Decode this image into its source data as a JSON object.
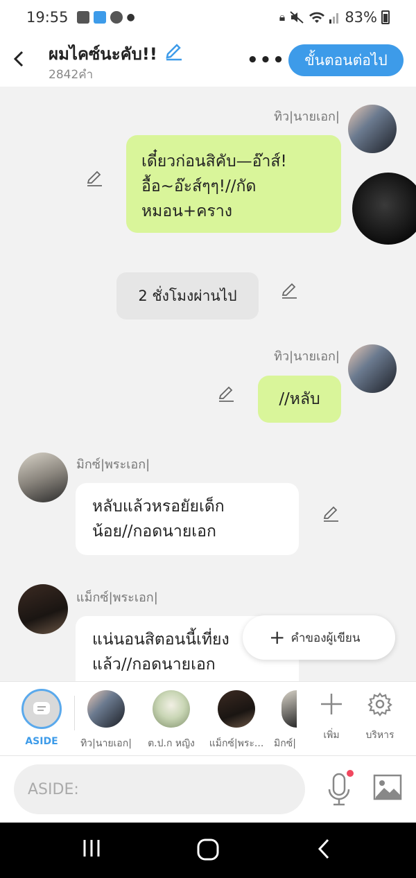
{
  "status": {
    "time": "19:55",
    "battery": "83%"
  },
  "header": {
    "title": "ผมไคซ์นะคับ!!",
    "word_count": "2842คำ",
    "more": "•••",
    "next_button": "ขั้นตอนต่อไป"
  },
  "messages": [
    {
      "speaker": "ทิว|นายเอก|",
      "text_lines": [
        "เดี๋ยวก่อนสิคับ—อ๊าส์!",
        "อื้อ~อ๊ะส์ๆๆ!//กัด",
        "หมอน+คราง"
      ]
    },
    {
      "system": "2 ชั่งโมงผ่านไป"
    },
    {
      "speaker": "ทิว|นายเอก|",
      "text_lines": [
        "//หลับ"
      ]
    },
    {
      "speaker": "มิกซ์|พระเอก|",
      "text_lines": [
        "หลับแล้วหรอยัยเด็ก",
        "น้อย//กอดนายเอก"
      ]
    },
    {
      "speaker": "แม็กซ์|พระเอก|",
      "text_lines": [
        "แน่นอนสิตอนนี้เที่ยง",
        "แล้ว//กอดนายเอก"
      ]
    }
  ],
  "fab": {
    "plus": "+",
    "label": "คำของผู้เขียน"
  },
  "characters": {
    "aside_label": "ASIDE",
    "items": [
      {
        "name": "ทิว|นายเอก|"
      },
      {
        "name": "ต.ป.ก หญิง"
      },
      {
        "name": "แม็กซ์|พระ..."
      },
      {
        "name": "มิกซ์|"
      }
    ],
    "add_label": "เพิ่ม",
    "manage_label": "บริหาร"
  },
  "composer": {
    "placeholder": "ASIDE:"
  },
  "colors": {
    "accent": "#3d9be9",
    "green_bubble": "#d9f59a",
    "mic_dot": "#f1485f"
  }
}
